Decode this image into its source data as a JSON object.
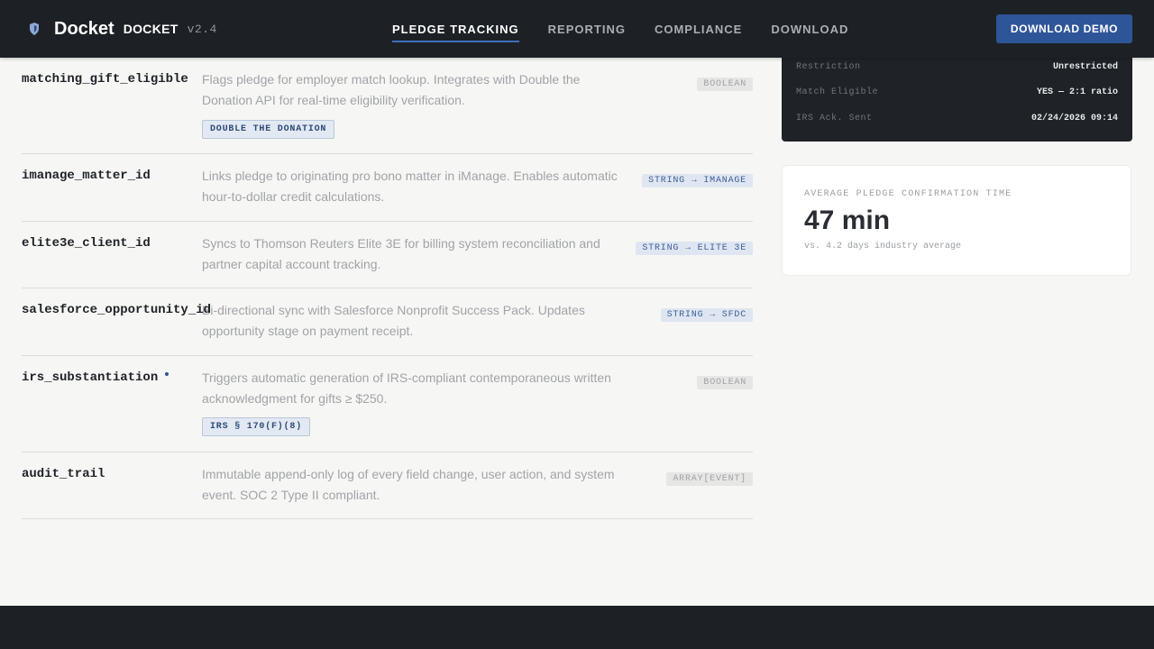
{
  "header": {
    "brand": "Docket",
    "brand_caps": "DOCKET",
    "version": "v2.4",
    "nav": [
      {
        "label": "PLEDGE TRACKING",
        "active": true
      },
      {
        "label": "REPORTING",
        "active": false
      },
      {
        "label": "COMPLIANCE",
        "active": false
      },
      {
        "label": "DOWNLOAD",
        "active": false
      }
    ],
    "cta_label": "DOWNLOAD DEMO"
  },
  "fields": [
    {
      "name": "matching_gift_eligible",
      "description": "Flags pledge for employer match lookup. Integrates with Double the Donation API for real-time eligibility verification.",
      "type": "BOOLEAN",
      "chip": "DOUBLE THE DONATION"
    },
    {
      "name": "imanage_matter_id",
      "description": "Links pledge to originating pro bono matter in iManage. Enables automatic hour-to-dollar credit calculations.",
      "type": "STRING → IMANAGE"
    },
    {
      "name": "elite3e_client_id",
      "description": "Syncs to Thomson Reuters Elite 3E for billing system reconciliation and partner capital account tracking.",
      "type": "STRING → ELITE 3E"
    },
    {
      "name": "salesforce_opportunity_id",
      "description": "Bi-directional sync with Salesforce Nonprofit Success Pack. Updates opportunity stage on payment receipt.",
      "type": "STRING → SFDC"
    },
    {
      "name": "irs_substantiation",
      "description": "Triggers automatic generation of IRS-compliant contemporaneous written acknowledgment for gifts ≥ $250.",
      "type": "BOOLEAN",
      "chip": "IRS § 170(F)(8)"
    },
    {
      "name": "audit_trail",
      "description": "Immutable append-only log of every field change, user action, and system event. SOC 2 Type II compliant.",
      "type": "ARRAY[EVENT]"
    }
  ],
  "pledge_card": {
    "rows": [
      {
        "label": "Restriction",
        "value": "Unrestricted"
      },
      {
        "label": "Match Eligible",
        "value": "YES — 2:1 ratio"
      },
      {
        "label": "IRS Ack. Sent",
        "value": "02/24/2026 09:14"
      }
    ]
  },
  "stat": {
    "label": "AVERAGE PLEDGE CONFIRMATION TIME",
    "value": "47 min",
    "sub": "vs. 4.2 days industry average"
  },
  "colors": {
    "accent": "#2e5598",
    "dark": "#1d2125",
    "background": "#f6f6f4"
  },
  "icons": {
    "logo": "shield-logo-icon"
  }
}
